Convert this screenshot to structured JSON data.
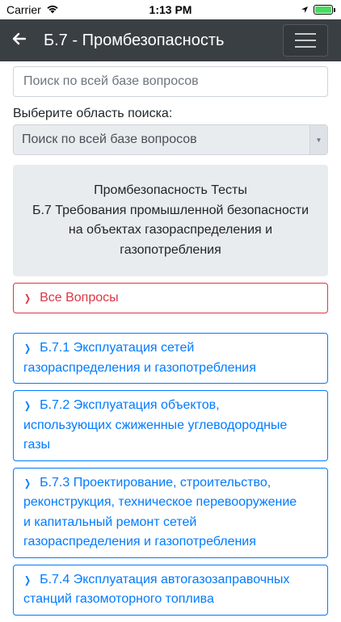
{
  "statusbar": {
    "carrier": "Carrier",
    "time": "1:13 PM"
  },
  "navbar": {
    "title": "Б.7 - Промбезопасность"
  },
  "search": {
    "placeholder": "Поиск по всей базе вопросов"
  },
  "area": {
    "label": "Выберите область поиска:",
    "selected": "Поиск по всей базе вопросов"
  },
  "info": {
    "lines": [
      "Промбезопасность Тесты",
      "Б.7 Требования промышленной безопасности",
      "на объектах газораспределения и",
      "газопотребления"
    ]
  },
  "all_questions": {
    "label": "Все Вопросы"
  },
  "topics": [
    {
      "lines": [
        "Б.7.1 Эксплуатация сетей",
        "газораспределения и газопотребления"
      ]
    },
    {
      "lines": [
        "Б.7.2 Эксплуатация объектов,",
        "использующих сжиженные углеводородные",
        "газы"
      ]
    },
    {
      "lines": [
        "Б.7.3 Проектирование, строительство,",
        "реконструкция, техническое перевооружение",
        "и капитальный ремонт сетей",
        "газораспределения и газопотребления"
      ]
    },
    {
      "lines": [
        "Б.7.4 Эксплуатация автогазозаправочных",
        "станций газомоторного топлива"
      ]
    }
  ],
  "colors": {
    "navbar": "#3a3f44",
    "danger": "#dc3545",
    "primary": "#007bff"
  }
}
